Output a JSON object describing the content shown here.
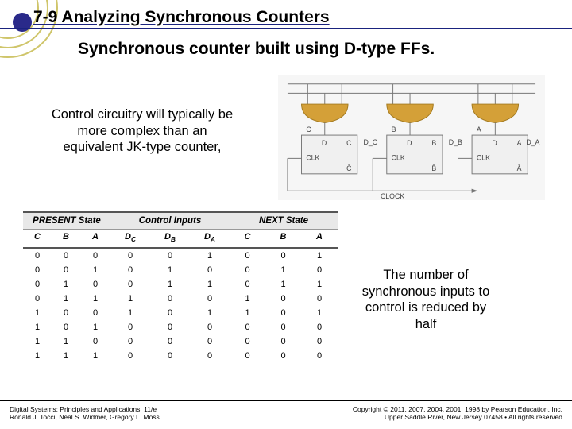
{
  "header": {
    "section_title": "7-9 Analyzing Synchronous Counters",
    "subtitle": "Synchronous counter built using D-type FFs."
  },
  "notes": {
    "left": "Control circuitry will typically be more complex than an equivalent JK-type counter,",
    "right": "The number of synchronous inputs to control is reduced by half"
  },
  "circuit": {
    "ff_labels": [
      "C",
      "B",
      "A"
    ],
    "d_labels": [
      "D_C",
      "D_B",
      "D_A"
    ],
    "pin_clk": "CLK",
    "pin_d": "D",
    "q": [
      "C",
      "B",
      "A"
    ],
    "qbar": [
      "C̄",
      "B̄",
      "Ā"
    ],
    "clock_label": "CLOCK"
  },
  "table": {
    "group_headers": [
      "PRESENT State",
      "Control Inputs",
      "NEXT State"
    ],
    "cols_present": [
      "C",
      "B",
      "A"
    ],
    "cols_control": [
      "D_C",
      "D_B",
      "D_A"
    ],
    "cols_next": [
      "C",
      "B",
      "A"
    ],
    "rows": [
      [
        "0",
        "0",
        "0",
        "0",
        "0",
        "1",
        "0",
        "0",
        "1"
      ],
      [
        "0",
        "0",
        "1",
        "0",
        "1",
        "0",
        "0",
        "1",
        "0"
      ],
      [
        "0",
        "1",
        "0",
        "0",
        "1",
        "1",
        "0",
        "1",
        "1"
      ],
      [
        "0",
        "1",
        "1",
        "1",
        "0",
        "0",
        "1",
        "0",
        "0"
      ],
      [
        "1",
        "0",
        "0",
        "1",
        "0",
        "1",
        "1",
        "0",
        "1"
      ],
      [
        "1",
        "0",
        "1",
        "0",
        "0",
        "0",
        "0",
        "0",
        "0"
      ],
      [
        "1",
        "1",
        "0",
        "0",
        "0",
        "0",
        "0",
        "0",
        "0"
      ],
      [
        "1",
        "1",
        "1",
        "0",
        "0",
        "0",
        "0",
        "0",
        "0"
      ]
    ]
  },
  "footer": {
    "left_line1": "Digital Systems: Principles and Applications, 11/e",
    "left_line2": "Ronald J. Tocci, Neal S. Widmer, Gregory L. Moss",
    "right_line1": "Copyright © 2011, 2007, 2004, 2001, 1998 by Pearson Education, Inc.",
    "right_line2": "Upper Saddle River, New Jersey 07458 • All rights reserved"
  },
  "chart_data": {
    "type": "table",
    "title": "D Flip-Flop Synchronous Counter State Table",
    "columns": [
      "C",
      "B",
      "A",
      "D_C",
      "D_B",
      "D_A",
      "C_next",
      "B_next",
      "A_next"
    ],
    "rows": [
      [
        0,
        0,
        0,
        0,
        0,
        1,
        0,
        0,
        1
      ],
      [
        0,
        0,
        1,
        0,
        1,
        0,
        0,
        1,
        0
      ],
      [
        0,
        1,
        0,
        0,
        1,
        1,
        0,
        1,
        1
      ],
      [
        0,
        1,
        1,
        1,
        0,
        0,
        1,
        0,
        0
      ],
      [
        1,
        0,
        0,
        1,
        0,
        1,
        1,
        0,
        1
      ],
      [
        1,
        0,
        1,
        0,
        0,
        0,
        0,
        0,
        0
      ],
      [
        1,
        1,
        0,
        0,
        0,
        0,
        0,
        0,
        0
      ],
      [
        1,
        1,
        1,
        0,
        0,
        0,
        0,
        0,
        0
      ]
    ]
  }
}
